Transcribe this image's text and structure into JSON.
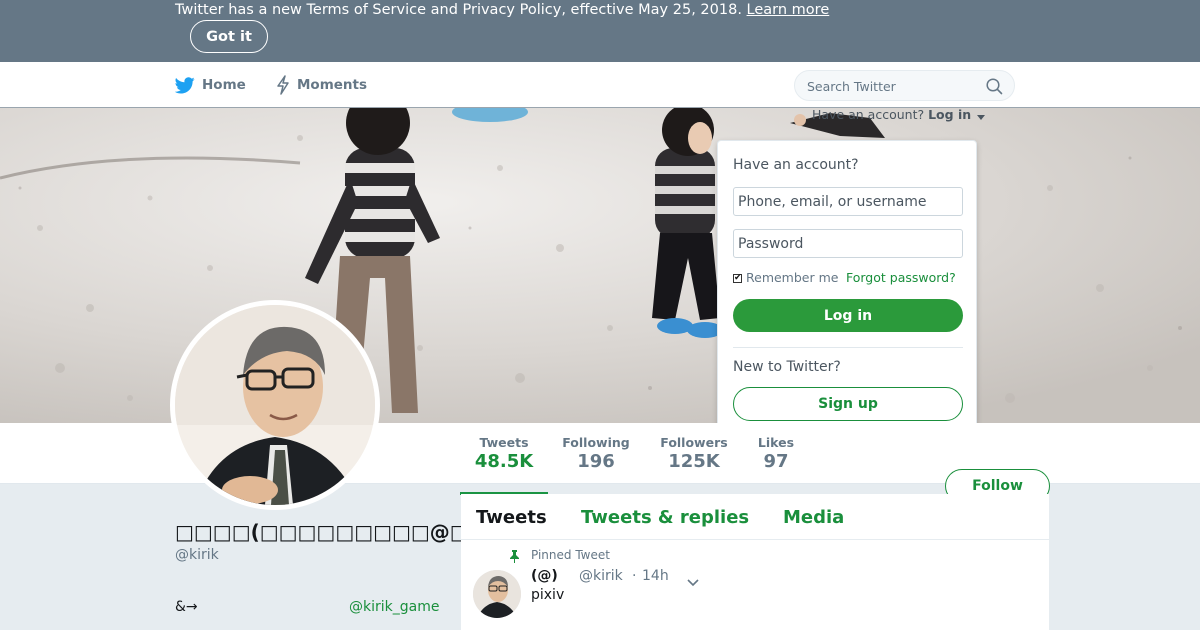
{
  "notice": {
    "text": "Twitter has a new Terms of Service and Privacy Policy, effective May 25, 2018.",
    "link": "Learn more",
    "button": "Got it"
  },
  "nav": {
    "home": "Home",
    "moments": "Moments",
    "search_placeholder": "Search Twitter",
    "icons": [
      "twitter-bird-icon",
      "lightning-icon",
      "search-icon"
    ]
  },
  "login": {
    "trigger_prefix": "Have an account?",
    "trigger_link": "Log in",
    "heading": "Have an account?",
    "username_placeholder": "Phone, email, or username",
    "password_placeholder": "Password",
    "remember": "Remember me",
    "separator": "·",
    "forgot": "Forgot password?",
    "login_button": "Log in",
    "new_prompt": "New to Twitter?",
    "signup_button": "Sign up"
  },
  "stats": [
    {
      "label": "Tweets",
      "value": "48.5K"
    },
    {
      "label": "Following",
      "value": "196"
    },
    {
      "label": "Followers",
      "value": "125K"
    },
    {
      "label": "Likes",
      "value": "97"
    }
  ],
  "follow_button": "Follow",
  "profile": {
    "name": "□□□□(□□□□□□□□□@□□□)",
    "handle": "@kirik",
    "bio": "&→",
    "link": "@kirik_game"
  },
  "tabs": [
    "Tweets",
    "Tweets & replies",
    "Media"
  ],
  "tweet": {
    "pinned_label": "Pinned Tweet",
    "name": "(@)",
    "handle": "@kirik",
    "separator": "·",
    "time": "14h",
    "text": "pixiv"
  },
  "colors": {
    "banner_bg": "#657786",
    "accent": "#1a8f3c",
    "login_button": "#2b9a3b",
    "twitter_blue": "#1da1f2"
  }
}
